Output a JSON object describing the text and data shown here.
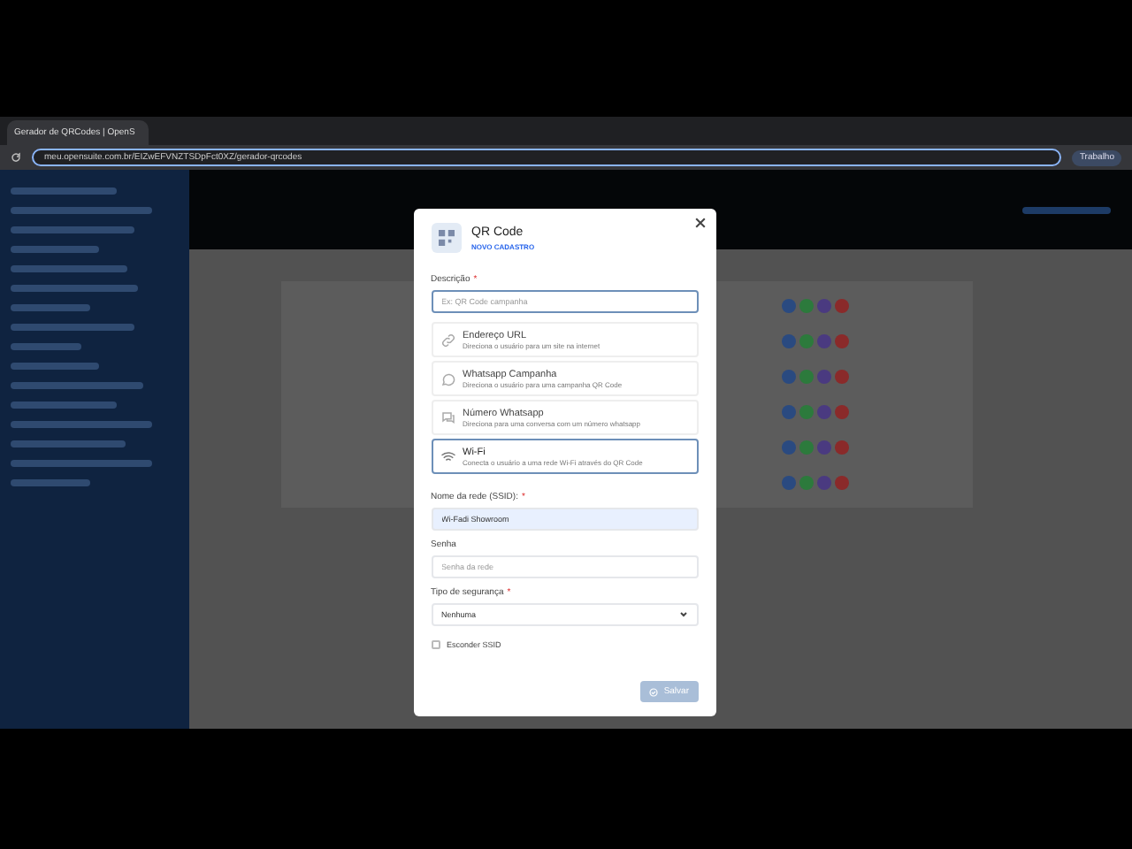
{
  "browser": {
    "tab_title": "Gerador de QRCodes | OpenS",
    "url": "meu.opensuite.com.br/EIZwEFVNZTSDpFct0XZ/gerador-qrcodes",
    "profile": "Trabalho"
  },
  "modal": {
    "title": "QR Code",
    "badge": "NOVO CADASTRO",
    "description": {
      "label": "Descrição",
      "required_mark": "*",
      "placeholder": "Ex: QR Code campanha"
    },
    "options": [
      {
        "kind": "link",
        "title": "Endereço URL",
        "subtitle": "Direciona o usuário para um site na internet",
        "selected": false
      },
      {
        "kind": "whatsapp",
        "title": "Whatsapp Campanha",
        "subtitle": "Direciona o usuário para uma campanha QR Code",
        "selected": false
      },
      {
        "kind": "chat",
        "title": "Número Whatsapp",
        "subtitle": "Direciona para uma conversa com um número whatsapp",
        "selected": false
      },
      {
        "kind": "wifi",
        "title": "Wi-Fi",
        "subtitle": "Conecta o usuário a uma rede Wi-Fi através do QR Code",
        "selected": true
      }
    ],
    "ssid": {
      "label": "Nome da rede (SSID):",
      "required_mark": "*",
      "value": "Wi-Fadi Showroom"
    },
    "password": {
      "label": "Senha",
      "placeholder": "Senha da rede"
    },
    "security": {
      "label": "Tipo de segurança",
      "required_mark": "*",
      "value": "Nenhuma"
    },
    "hide_ssid": {
      "label": "Esconder SSID",
      "checked": false
    },
    "save_button": {
      "label": "Salvar",
      "disabled": true
    }
  }
}
